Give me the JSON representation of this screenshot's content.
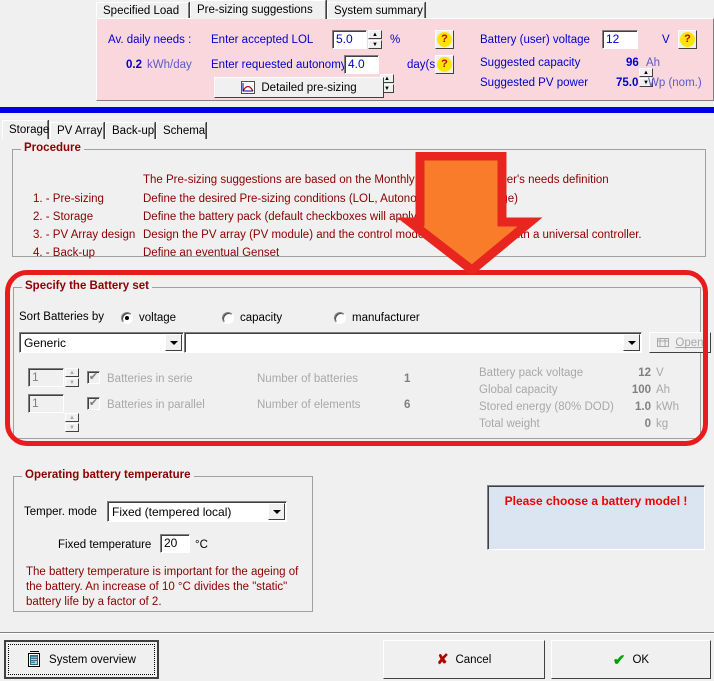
{
  "top_tabs": [
    {
      "label": "Specified Load",
      "selected": false
    },
    {
      "label": "Pre-sizing suggestions",
      "selected": true
    },
    {
      "label": "System summary",
      "selected": false
    }
  ],
  "summary": {
    "daily_needs_label": "Av. daily needs :",
    "daily_needs_value": "0.2",
    "daily_needs_unit": "kWh/day",
    "lol_label": "Enter accepted LOL",
    "lol_value": "5.0",
    "lol_unit": "%",
    "autonomy_label": "Enter requested autonomy",
    "autonomy_value": "4.0",
    "autonomy_unit": "day(s)",
    "detailed_button": "Detailed pre-sizing",
    "help_glyph": "?",
    "battery_voltage_label": "Battery (user) voltage",
    "battery_voltage_value": "12",
    "battery_voltage_unit": "V",
    "suggested_capacity_label": "Suggested capacity",
    "suggested_capacity_value": "96",
    "suggested_capacity_unit": "Ah",
    "suggested_pv_label": "Suggested PV power",
    "suggested_pv_value": "75.0",
    "suggested_pv_unit": "Wp (nom.)"
  },
  "lower_tabs": [
    {
      "label": "Storage",
      "selected": true
    },
    {
      "label": "PV Array",
      "selected": false
    },
    {
      "label": "Back-up",
      "selected": false
    },
    {
      "label": "Schema",
      "selected": false
    }
  ],
  "procedure": {
    "caption": "Procedure",
    "rows": [
      {
        "step": "",
        "text": "The Pre-sizing  suggestions are based on the Monthly meteo and the user's needs definition"
      },
      {
        "step": "1. - Pre-sizing",
        "text": "Define the desired Pre-sizing  conditions  (LOL, Autonomy, Battery voltage)"
      },
      {
        "step": "2. - Storage",
        "text": "Define the battery pack   (default checkboxes will apply the suggestions)"
      },
      {
        "step": "3. - PV Array design",
        "text": "Design the PV array  (PV module) and the control mode. You may begin with a universal controller."
      },
      {
        "step": "4. - Back-up",
        "text": "Define an eventual Genset"
      }
    ]
  },
  "battery_set": {
    "caption": "Specify the Battery set",
    "sort_label": "Sort Batteries by",
    "sort_options": [
      {
        "label": "voltage",
        "selected": true
      },
      {
        "label": "capacity",
        "selected": false
      },
      {
        "label": "manufacturer",
        "selected": false
      }
    ],
    "sort_combo_value": "Generic",
    "model_combo_value": "",
    "open_button": "Open",
    "series_value": "1",
    "series_label": "Batteries in serie",
    "parallel_value": "1",
    "parallel_label": "Batteries in parallel",
    "checkbox_glyph": "✔",
    "readouts_left": [
      {
        "label": "Number of batteries",
        "value": "1",
        "unit": ""
      },
      {
        "label": "Number of elements",
        "value": "6",
        "unit": ""
      }
    ],
    "readouts_right": [
      {
        "label": "Battery pack voltage",
        "value": "12",
        "unit": "V"
      },
      {
        "label": "Global capacity",
        "value": "100",
        "unit": "Ah"
      },
      {
        "label": "Stored energy (80% DOD)",
        "value": "1.0",
        "unit": "kWh"
      },
      {
        "label": "Total weight",
        "value": "0",
        "unit": "kg"
      }
    ]
  },
  "temperature": {
    "caption": "Operating battery temperature",
    "mode_label": "Temper. mode",
    "mode_value": "Fixed  (tempered local)",
    "fixed_label": "Fixed temperature",
    "fixed_value": "20",
    "fixed_unit": "°C",
    "note": "The battery temperature is important for the ageing of the battery. An increase of 10 °C divides the \"static\" battery life by a factor of 2."
  },
  "message": {
    "text": "Please choose a battery model !"
  },
  "footer": {
    "system_overview": "System overview",
    "cancel": "Cancel",
    "ok": "OK",
    "cancel_glyph": "✘",
    "ok_glyph": "✔"
  },
  "annotations": {
    "arrow_fill": "#f97c2b",
    "arrow_stroke": "#e8261f",
    "rect_color": "#e81c1c"
  }
}
